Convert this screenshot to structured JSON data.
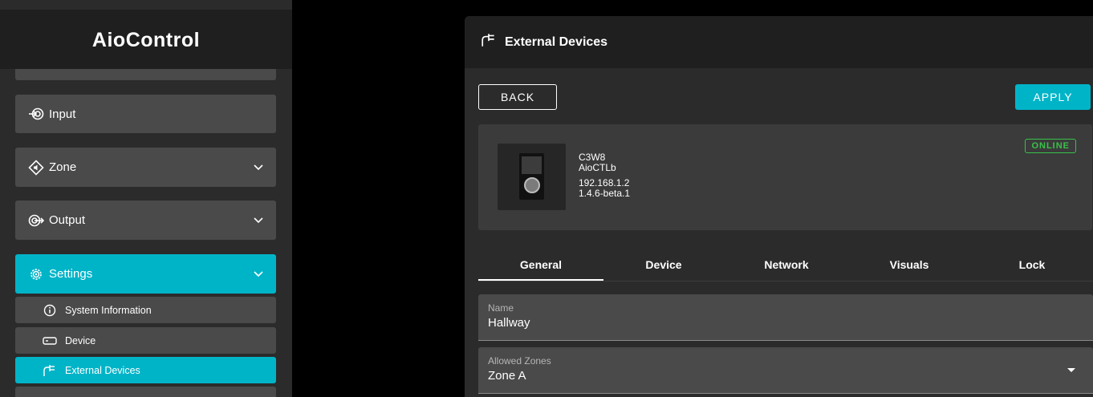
{
  "app": {
    "name": "AioControl"
  },
  "sidebar": {
    "items": [
      {
        "label": "Input",
        "icon": "input-icon"
      },
      {
        "label": "Zone",
        "icon": "zone-icon"
      },
      {
        "label": "Output",
        "icon": "output-icon"
      },
      {
        "label": "Settings",
        "icon": "gear-icon"
      }
    ],
    "settings_sub": [
      {
        "label": "System Information",
        "icon": "info-icon"
      },
      {
        "label": "Device",
        "icon": "device-icon"
      },
      {
        "label": "External Devices",
        "icon": "external-devices-icon"
      }
    ]
  },
  "page": {
    "title": "External Devices"
  },
  "actions": {
    "back": "BACK",
    "apply": "APPLY"
  },
  "device": {
    "name": "C3W8",
    "model": "AioCTLb",
    "ip": "192.168.1.2",
    "firmware": "1.4.6-beta.1",
    "status": "ONLINE"
  },
  "tabs": [
    "General",
    "Device",
    "Network",
    "Visuals",
    "Lock"
  ],
  "form": {
    "name_label": "Name",
    "name_value": "Hallway",
    "zones_label": "Allowed Zones",
    "zones_value": "Zone A"
  },
  "colors": {
    "accent": "#00b4c8",
    "online": "#38c24a",
    "panel": "#2b2b2b",
    "item": "#4a4a4a"
  }
}
